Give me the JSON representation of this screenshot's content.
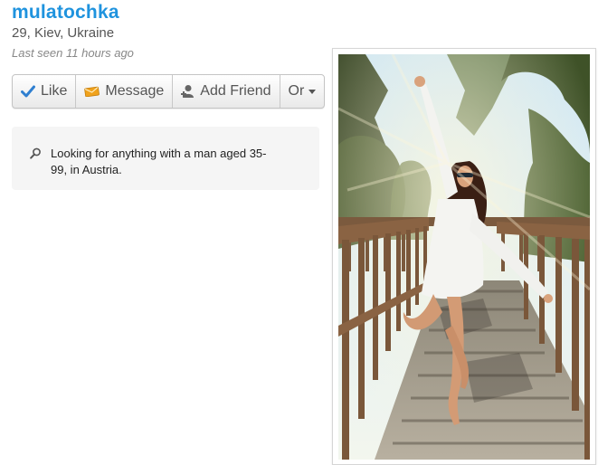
{
  "profile": {
    "username": "mulatochka",
    "details": "29, Kiev, Ukraine",
    "last_seen": "Last seen 11 hours ago"
  },
  "actions": {
    "like": "Like",
    "message": "Message",
    "add_friend": "Add Friend",
    "or": "Or"
  },
  "looking_for": {
    "text": "Looking for anything with a man aged 35-99, in Austria."
  },
  "colors": {
    "username": "#1f93de",
    "like_check": "#2f7fd0",
    "message_icon": "#f0a21c"
  },
  "icons": [
    "check-icon",
    "envelope-icon",
    "person-plus-icon",
    "caret-down-icon",
    "search-icon"
  ]
}
